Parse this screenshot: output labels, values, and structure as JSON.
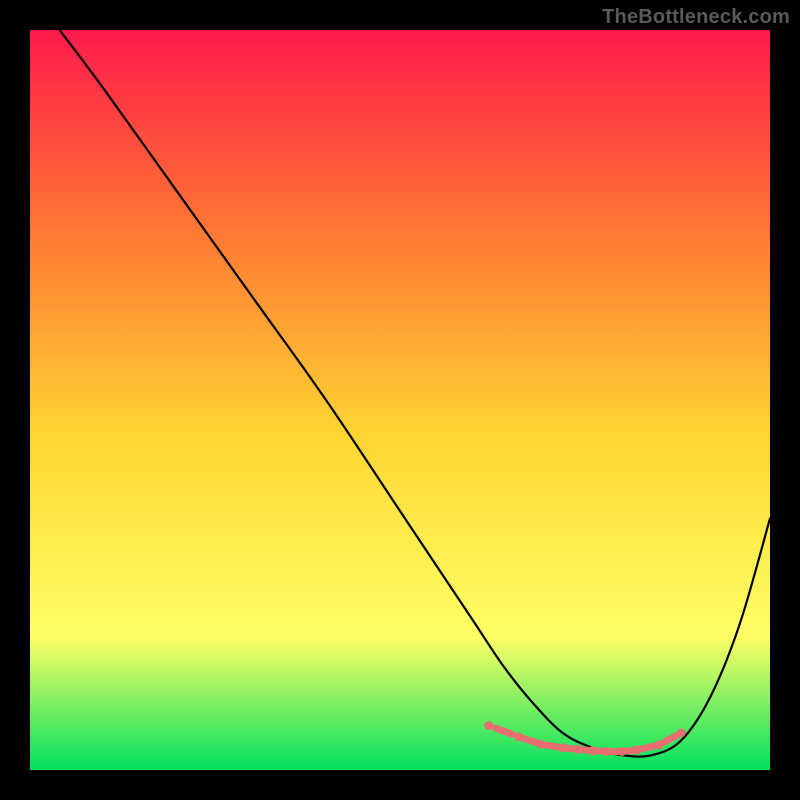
{
  "watermark": "TheBottleneck.com",
  "colors": {
    "gradient_top": "#ff1a4b",
    "gradient_mid1": "#ff7a33",
    "gradient_mid2": "#ffd633",
    "gradient_mid3": "#ffff66",
    "gradient_bottom": "#00e060",
    "curve": "#000000",
    "dots": "#e76f6f",
    "frame": "#000000"
  },
  "chart_data": {
    "type": "line",
    "title": "",
    "xlabel": "",
    "ylabel": "",
    "xlim": [
      0,
      100
    ],
    "ylim": [
      0,
      100
    ],
    "series": [
      {
        "name": "bottleneck-curve",
        "x": [
          4,
          10,
          20,
          30,
          40,
          50,
          56,
          60,
          64,
          68,
          72,
          76,
          80,
          84,
          88,
          92,
          96,
          100
        ],
        "y": [
          100,
          92,
          78,
          64,
          50,
          35,
          26,
          20,
          14,
          9,
          5,
          3,
          2,
          2,
          4,
          10,
          20,
          34
        ]
      }
    ],
    "markers": {
      "name": "bottom-dots",
      "x": [
        62,
        66,
        69,
        72,
        74,
        76,
        78,
        80,
        82,
        85,
        88
      ],
      "y": [
        6,
        4.5,
        3.5,
        3,
        2.8,
        2.6,
        2.5,
        2.5,
        2.7,
        3.4,
        5
      ]
    }
  }
}
